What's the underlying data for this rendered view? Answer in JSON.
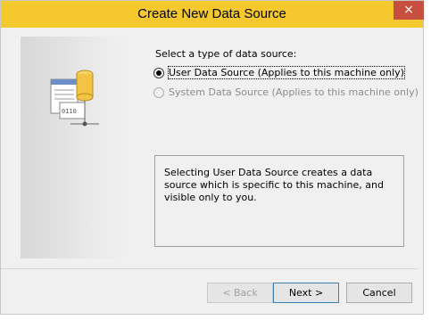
{
  "window": {
    "title": "Create New Data Source",
    "close_glyph": "×"
  },
  "content": {
    "prompt": "Select a type of data source:",
    "options": [
      {
        "label": "User Data Source (Applies to this machine only)",
        "selected": true,
        "enabled": true
      },
      {
        "label": "System Data Source (Applies to this machine only)",
        "selected": false,
        "enabled": false
      }
    ],
    "description": "Selecting User Data Source creates a data source which is specific to this machine, and visible only to you."
  },
  "buttons": {
    "back": "< Back",
    "next": "Next >",
    "cancel": "Cancel"
  }
}
